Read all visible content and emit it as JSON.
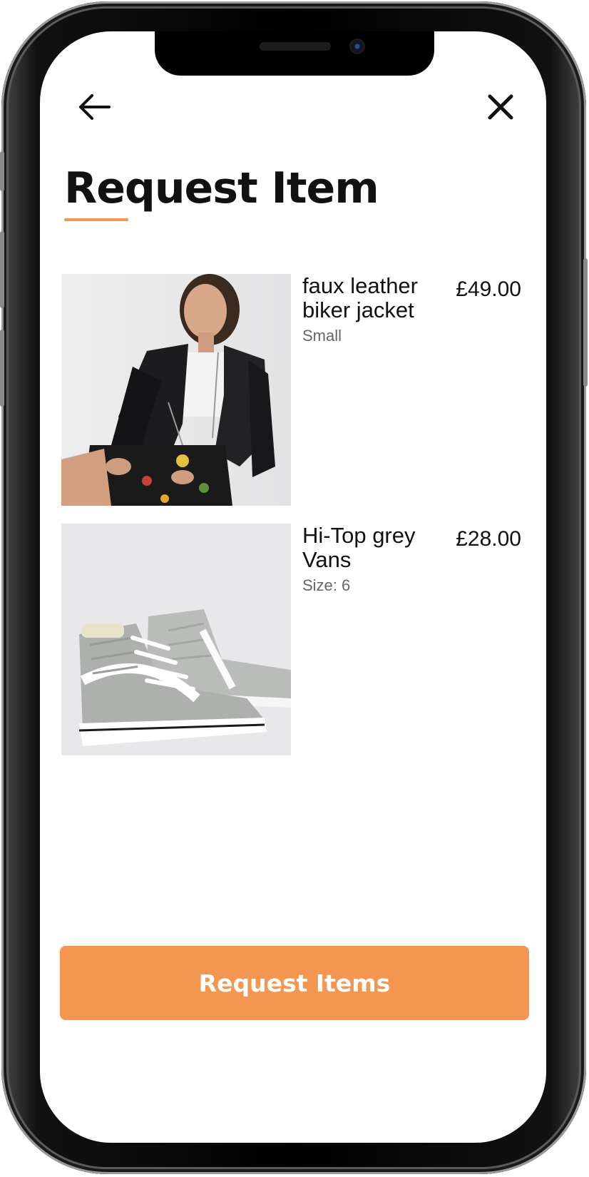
{
  "header": {
    "back_icon": "arrow-left-icon",
    "close_icon": "close-icon"
  },
  "page": {
    "title": "Request Item"
  },
  "items": [
    {
      "name": "faux leather biker jacket",
      "size": "Small",
      "price": "£49.00"
    },
    {
      "name": "Hi-Top grey Vans",
      "size": "Size: 6",
      "price": "£28.00"
    }
  ],
  "actions": {
    "request_label": "Request Items"
  },
  "colors": {
    "accent": "#f4964f",
    "text": "#111111",
    "muted": "#666666",
    "background": "#ffffff"
  }
}
